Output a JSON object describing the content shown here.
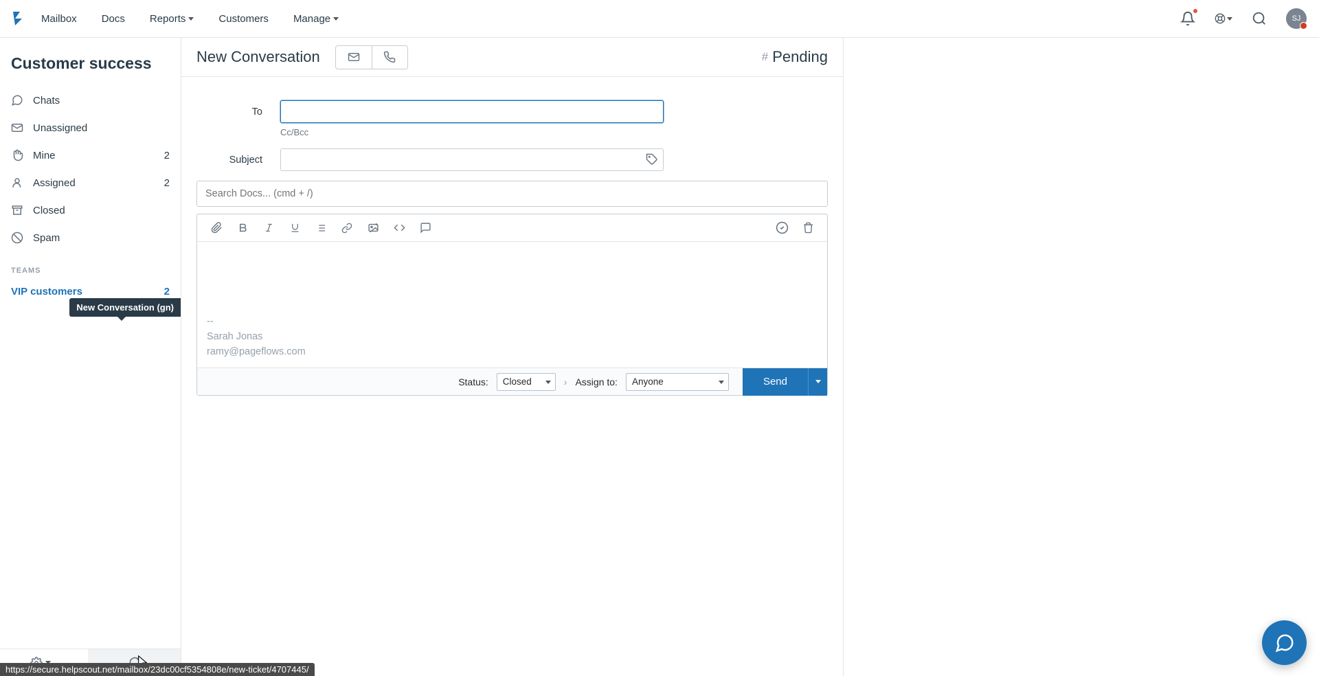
{
  "nav": {
    "mailbox": "Mailbox",
    "docs": "Docs",
    "reports": "Reports",
    "customers": "Customers",
    "manage": "Manage"
  },
  "avatar_initials": "SJ",
  "sidebar": {
    "title": "Customer success",
    "folders": [
      {
        "id": "chats",
        "label": "Chats",
        "count": ""
      },
      {
        "id": "unassigned",
        "label": "Unassigned",
        "count": ""
      },
      {
        "id": "mine",
        "label": "Mine",
        "count": "2"
      },
      {
        "id": "assigned",
        "label": "Assigned",
        "count": "2"
      },
      {
        "id": "closed",
        "label": "Closed",
        "count": ""
      },
      {
        "id": "spam",
        "label": "Spam",
        "count": ""
      }
    ],
    "teams_label": "TEAMS",
    "team": {
      "label": "VIP customers",
      "count": "2"
    },
    "tooltip": "New Conversation (gn)"
  },
  "header": {
    "title": "New Conversation",
    "pending": "Pending"
  },
  "form": {
    "to_label": "To",
    "subject_label": "Subject",
    "ccbcc": "Cc/Bcc",
    "docs_placeholder": "Search Docs... (cmd + /)"
  },
  "signature": {
    "divider": "--",
    "name": "Sarah Jonas",
    "email": "ramy@pageflows.com"
  },
  "footer": {
    "status_label": "Status:",
    "status_value": "Closed",
    "assign_label": "Assign to:",
    "assign_value": "Anyone",
    "send": "Send"
  },
  "status_url": "https://secure.helpscout.net/mailbox/23dc00cf5354808e/new-ticket/4707445/"
}
